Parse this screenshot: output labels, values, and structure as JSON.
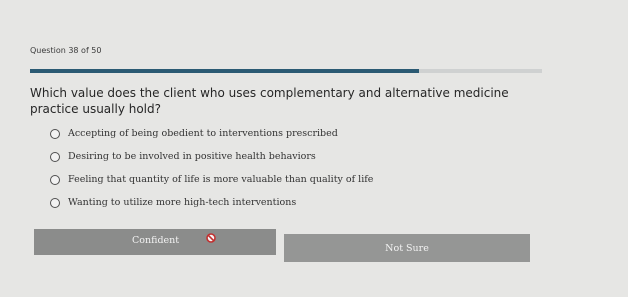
{
  "question_counter": "Question 38 of 50",
  "progress_fraction": 0.76,
  "colors": {
    "progress": "#2b5a73",
    "prohibit_icon": "#c23030"
  },
  "question_text": "Which value does the client who uses complementary and alternative medicine practice usually hold?",
  "options": [
    {
      "label": "Accepting of being obedient to interventions prescribed"
    },
    {
      "label": "Desiring to be involved in positive health behaviors"
    },
    {
      "label": "Feeling that quantity of life is more valuable than quality of life"
    },
    {
      "label": "Wanting to utilize more high-tech interventions"
    }
  ],
  "buttons": {
    "confident": "Confident",
    "confident_icon": "prohibit-icon",
    "not_sure": "Not Sure"
  }
}
